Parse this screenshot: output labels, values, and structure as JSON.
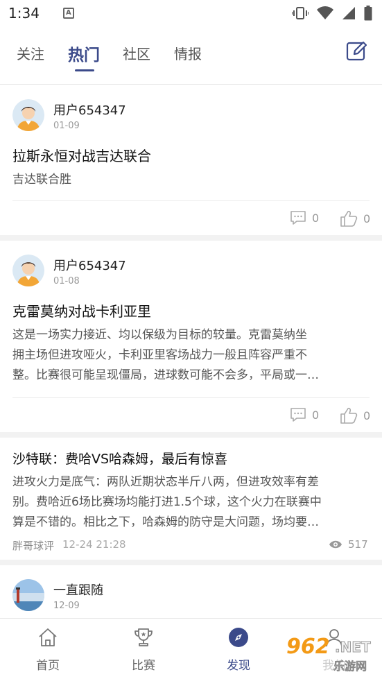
{
  "status_bar": {
    "time": "1:34"
  },
  "tabs": [
    {
      "label": "关注"
    },
    {
      "label": "热门"
    },
    {
      "label": "社区"
    },
    {
      "label": "情报"
    }
  ],
  "accent_color": "#3b4a8a",
  "posts": [
    {
      "user": "用户654347",
      "date": "01-09",
      "title": "拉斯永恒对战吉达联合",
      "body": "吉达联合胜",
      "comments": "0",
      "likes": "0"
    },
    {
      "user": "用户654347",
      "date": "01-08",
      "title": "克雷莫纳对战卡利亚里",
      "body_lines": [
        "这是一场实力接近、均以保级为目标的较量。克雷莫纳坐",
        "拥主场但进攻哑火，卡利亚里客场战力一般且阵容严重不",
        "整。比赛很可能呈现僵局，进球数可能不会多，平局或一…"
      ],
      "comments": "0",
      "likes": "0"
    }
  ],
  "article": {
    "title": "沙特联：费哈VS哈森姆，最后有惊喜",
    "body_lines": [
      "进攻火力是底气：两队近期状态半斤八两，但进攻效率有差",
      "别。费哈近6场比赛场均能打进1.5个球，这个火力在联赛中",
      "算是不错的。相比之下，哈森姆的防守是大问题，场均要…"
    ],
    "author": "胖哥球评",
    "time": "12-24 21:28",
    "views": "517"
  },
  "partial_post": {
    "user": "一直跟随",
    "date": "12-09"
  },
  "bottom_nav": [
    {
      "label": "首页",
      "icon": "home-icon"
    },
    {
      "label": "比赛",
      "icon": "trophy-icon"
    },
    {
      "label": "发现",
      "icon": "compass-icon"
    },
    {
      "label": "我的",
      "icon": "profile-icon"
    }
  ],
  "watermark": {
    "main": "962",
    "net": ".NET",
    "sub": "乐游网"
  }
}
